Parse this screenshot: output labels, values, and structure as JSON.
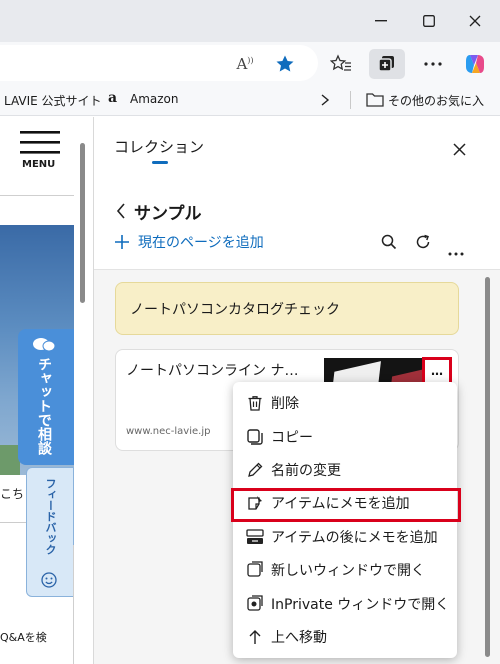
{
  "favorites": {
    "lavie": "LAVIE 公式サイト",
    "amazon": "Amazon",
    "other": "その他のお気に入"
  },
  "toolbar": {
    "read_aloud": "A"
  },
  "page": {
    "menu_label": "MENU",
    "chat_label": "チャットで相談",
    "feedback_label": "フィードバック",
    "partial_text": "こちら",
    "qa_text": "Q&Aを検"
  },
  "panel": {
    "title": "コレクション",
    "collection_name": "サンプル",
    "add_page_label": "現在のページを追加",
    "note_text": "ノートパソコンカタログチェック",
    "card_title": "ノートパソコンライン ナ…",
    "card_domain": "www.nec-lavie.jp",
    "more_label": "…"
  },
  "context_menu": {
    "items": [
      {
        "label": "削除",
        "icon": "trash-icon"
      },
      {
        "label": "コピー",
        "icon": "copy-icon"
      },
      {
        "label": "名前の変更",
        "icon": "pencil-icon"
      },
      {
        "label": "アイテムにメモを追加",
        "icon": "note-add-icon",
        "highlighted": true
      },
      {
        "label": "アイテムの後にメモを追加",
        "icon": "note-after-icon"
      },
      {
        "label": "新しいウィンドウで開く",
        "icon": "new-window-icon"
      },
      {
        "label": "InPrivate ウィンドウで開く",
        "icon": "inprivate-window-icon"
      },
      {
        "label": "上へ移動",
        "icon": "arrow-up-icon"
      }
    ]
  },
  "colors": {
    "accent": "#0f6cbd",
    "highlight_border": "#d9001b",
    "note_bg": "#f8efc8",
    "chat_blue": "#4a8fd9",
    "hero_blue": "#3d6fa8"
  }
}
